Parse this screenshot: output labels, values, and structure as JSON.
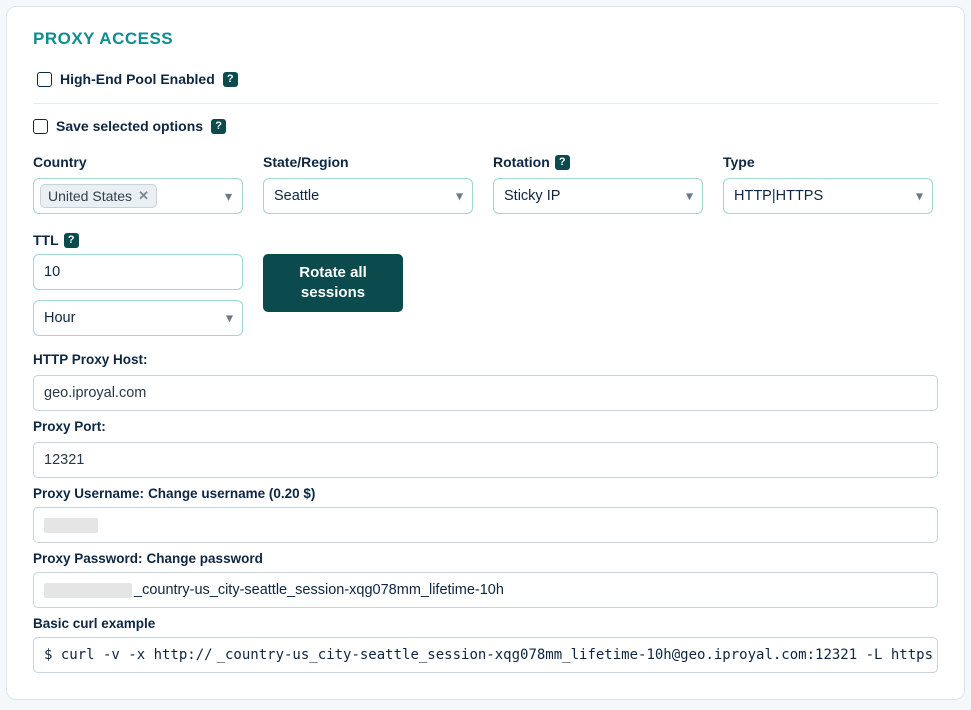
{
  "title": "PROXY ACCESS",
  "high_end": {
    "label": "High-End Pool Enabled"
  },
  "save_opts": {
    "label": "Save selected options"
  },
  "country": {
    "label": "Country",
    "chip": "United States"
  },
  "state": {
    "label": "State/Region",
    "value": "Seattle"
  },
  "rotation": {
    "label": "Rotation",
    "value": "Sticky IP"
  },
  "type": {
    "label": "Type",
    "value": "HTTP|HTTPS"
  },
  "ttl": {
    "label": "TTL",
    "value": "10",
    "unit": "Hour"
  },
  "rotate_btn": "Rotate all\nsessions",
  "host": {
    "label": "HTTP Proxy Host:",
    "value": "geo.iproyal.com"
  },
  "port": {
    "label": "Proxy Port:",
    "value": "12321"
  },
  "username": {
    "label_prefix": "Proxy Username:",
    "link": "Change username (0.20 $)",
    "value_masked": true
  },
  "password": {
    "label_prefix": "Proxy Password:",
    "link": "Change password",
    "value_prefix_masked": true,
    "value_suffix": "_country-us_city-seattle_session-xqg078mm_lifetime-10h"
  },
  "curl": {
    "label": "Basic curl example",
    "prefix": "$ curl -v -x http://",
    "masked_mid": true,
    "suffix": "_country-us_city-seattle_session-xqg078mm_lifetime-10h@geo.iproyal.com:12321 -L https"
  }
}
